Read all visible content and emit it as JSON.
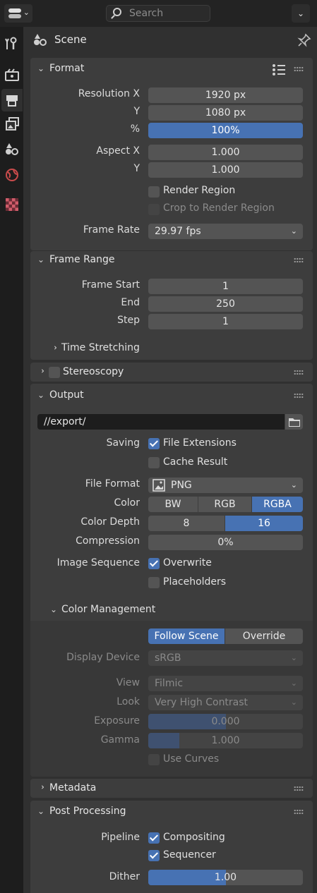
{
  "header": {
    "search_placeholder": "Search"
  },
  "context": {
    "title": "Scene"
  },
  "format": {
    "title": "Format",
    "resolution_x_label": "Resolution X",
    "resolution_x": "1920 px",
    "resolution_y_label": "Y",
    "resolution_y": "1080 px",
    "percent_label": "%",
    "percent": "100%",
    "aspect_x_label": "Aspect X",
    "aspect_x": "1.000",
    "aspect_y_label": "Y",
    "aspect_y": "1.000",
    "render_region": "Render Region",
    "crop_region": "Crop to Render Region",
    "frame_rate_label": "Frame Rate",
    "frame_rate": "29.97 fps"
  },
  "frame_range": {
    "title": "Frame Range",
    "start_label": "Frame Start",
    "start": "1",
    "end_label": "End",
    "end": "250",
    "step_label": "Step",
    "step": "1",
    "time_stretching": "Time Stretching"
  },
  "stereoscopy": {
    "title": "Stereoscopy"
  },
  "output": {
    "title": "Output",
    "path": "//export/",
    "saving_label": "Saving",
    "file_extensions": "File Extensions",
    "cache_result": "Cache Result",
    "file_format_label": "File Format",
    "file_format": "PNG",
    "color_label": "Color",
    "color_options": [
      "BW",
      "RGB",
      "RGBA"
    ],
    "color_selected": "RGBA",
    "depth_label": "Color Depth",
    "depth_options": [
      "8",
      "16"
    ],
    "depth_selected": "16",
    "compression_label": "Compression",
    "compression": "0%",
    "sequence_label": "Image Sequence",
    "overwrite": "Overwrite",
    "placeholders": "Placeholders"
  },
  "color_management": {
    "title": "Color Management",
    "mode_options": [
      "Follow Scene",
      "Override"
    ],
    "mode_selected": "Follow Scene",
    "display_device_label": "Display Device",
    "display_device": "sRGB",
    "view_label": "View",
    "view": "Filmic",
    "look_label": "Look",
    "look": "Very High Contrast",
    "exposure_label": "Exposure",
    "exposure": "0.000",
    "exposure_fill": 0.5,
    "gamma_label": "Gamma",
    "gamma": "1.000",
    "gamma_fill": 0.2,
    "use_curves": "Use Curves"
  },
  "metadata": {
    "title": "Metadata"
  },
  "post_processing": {
    "title": "Post Processing",
    "pipeline_label": "Pipeline",
    "compositing": "Compositing",
    "sequencer": "Sequencer",
    "dither_label": "Dither",
    "dither": "1.00",
    "dither_fill": 0.5
  },
  "colors": {
    "accent": "#4772b3",
    "panel": "#3d3d3d",
    "field": "#545454",
    "background": "#303030"
  }
}
